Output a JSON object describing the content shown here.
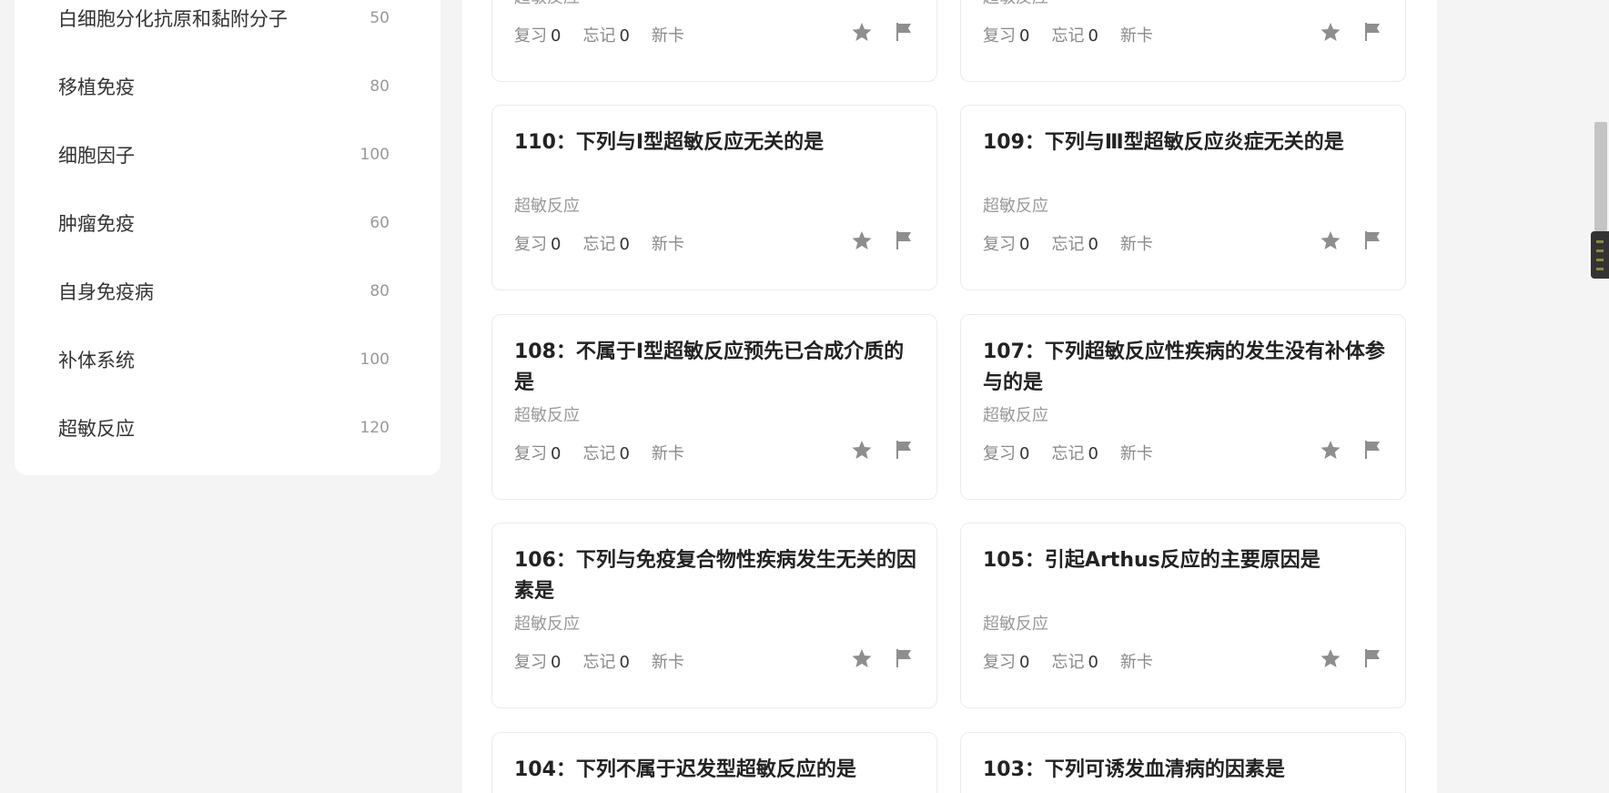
{
  "sidebar": {
    "items": [
      {
        "label": "白细胞分化抗原和黏附分子",
        "count": "50"
      },
      {
        "label": "移植免疫",
        "count": "80"
      },
      {
        "label": "细胞因子",
        "count": "100"
      },
      {
        "label": "肿瘤免疫",
        "count": "60"
      },
      {
        "label": "自身免疫病",
        "count": "80"
      },
      {
        "label": "补体系统",
        "count": "100"
      },
      {
        "label": "超敏反应",
        "count": "120"
      }
    ]
  },
  "stats_labels": {
    "review": "复习",
    "forget": "忘记",
    "new": "新卡"
  },
  "cards": [
    {
      "title": "",
      "tag": "超敏反应",
      "review": "0",
      "forget": "0"
    },
    {
      "title": "",
      "tag": "超敏反应",
      "review": "0",
      "forget": "0"
    },
    {
      "title": "110：下列与Ⅰ型超敏反应无关的是",
      "tag": "超敏反应",
      "review": "0",
      "forget": "0"
    },
    {
      "title": "109：下列与Ⅲ型超敏反应炎症无关的是",
      "tag": "超敏反应",
      "review": "0",
      "forget": "0"
    },
    {
      "title": "108：不属于Ⅰ型超敏反应预先已合成介质的是",
      "tag": "超敏反应",
      "review": "0",
      "forget": "0"
    },
    {
      "title": "107：下列超敏反应性疾病的发生没有补体参与的是",
      "tag": "超敏反应",
      "review": "0",
      "forget": "0"
    },
    {
      "title": "106：下列与免疫复合物性疾病发生无关的因素是",
      "tag": "超敏反应",
      "review": "0",
      "forget": "0"
    },
    {
      "title": "105：引起Arthus反应的主要原因是",
      "tag": "超敏反应",
      "review": "0",
      "forget": "0"
    },
    {
      "title": "104：下列不属于迟发型超敏反应的是",
      "tag": "",
      "review": "",
      "forget": ""
    },
    {
      "title": "103：下列可诱发血清病的因素是",
      "tag": "",
      "review": "",
      "forget": ""
    }
  ],
  "colors": {
    "icon": "#8e8e8e",
    "background": "#f4f4f4"
  }
}
